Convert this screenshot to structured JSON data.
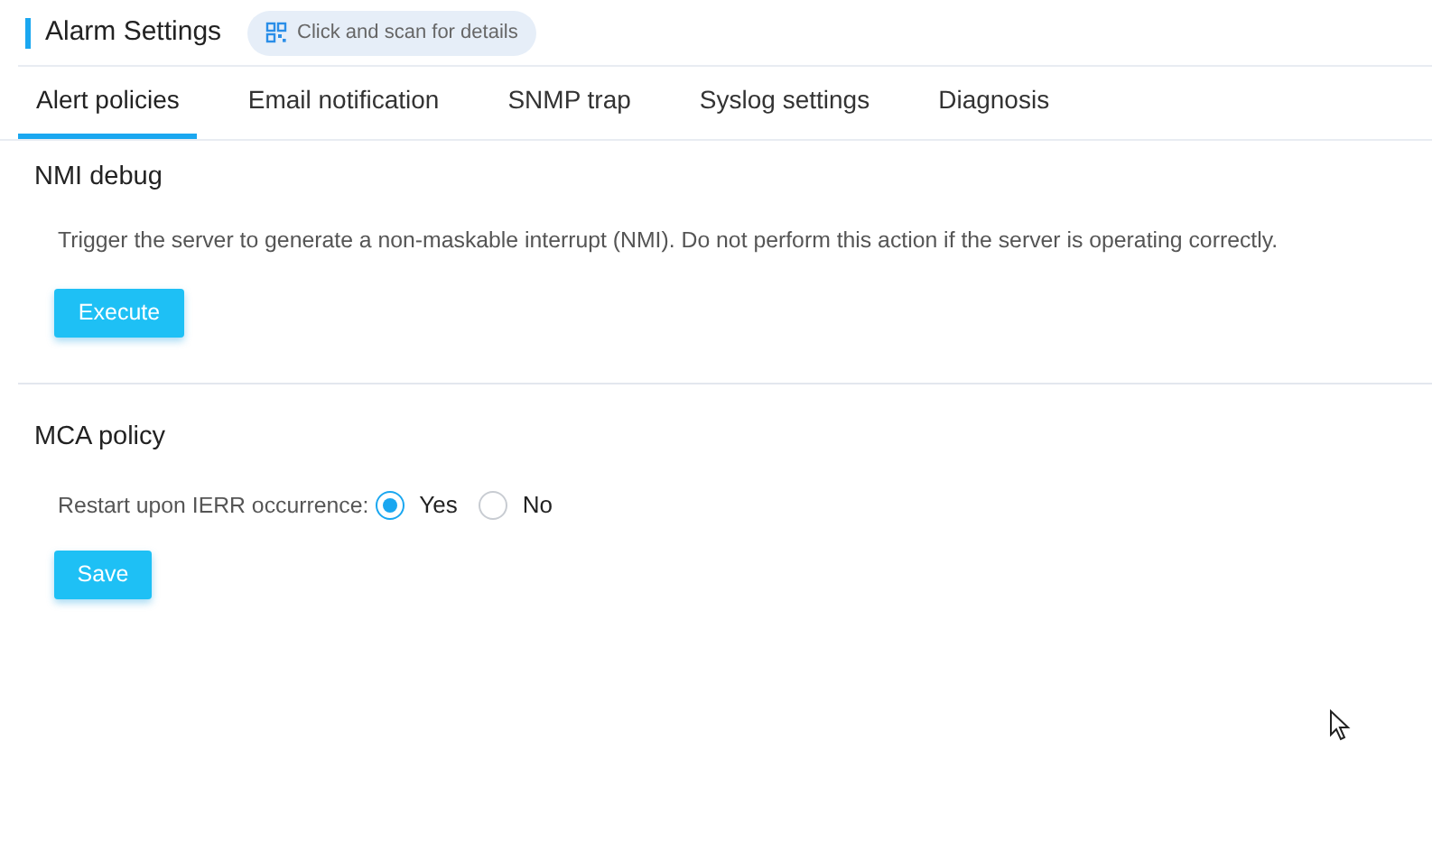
{
  "header": {
    "title": "Alarm Settings",
    "scan_hint": "Click and scan for details"
  },
  "tabs": [
    {
      "label": "Alert policies",
      "selected": true
    },
    {
      "label": "Email notification",
      "selected": false
    },
    {
      "label": "SNMP trap",
      "selected": false
    },
    {
      "label": "Syslog settings",
      "selected": false
    },
    {
      "label": "Diagnosis",
      "selected": false
    }
  ],
  "nmi_debug": {
    "title": "NMI debug",
    "description": "Trigger the server to generate a non-maskable interrupt (NMI). Do not perform this action if the server is operating correctly.",
    "button": "Execute"
  },
  "mca_policy": {
    "title": "MCA policy",
    "label": "Restart upon IERR occurrence:",
    "options": [
      {
        "label": "Yes",
        "selected": true
      },
      {
        "label": "No",
        "selected": false
      }
    ],
    "button": "Save"
  }
}
